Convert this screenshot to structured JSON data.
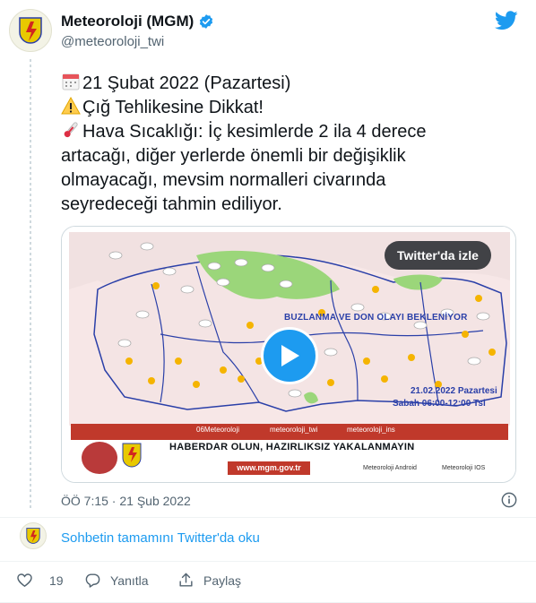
{
  "author": {
    "name": "Meteoroloji (MGM)",
    "handle": "@meteoroloji_twi",
    "avatar_text": "METEOROLOJİ",
    "verified": true
  },
  "tweet": {
    "lines": [
      "21 Şubat 2022 (Pazartesi)",
      "Çığ Tehlikesine Dikkat!",
      "Hava Sıcaklığı: İç kesimlerde 2 ila 4 derece",
      "artacağı, diğer yerlerde önemli bir değişiklik",
      "olmayacağı, mevsim normalleri civarında",
      "seyredeceği tahmin ediliyor."
    ],
    "emoji_names": [
      "calendar-icon",
      "warning-icon",
      "thermometer-icon"
    ]
  },
  "media": {
    "watch_label": "Twitter'da izle",
    "headline": "BUZLANMA VE DON OLAYI BEKLENİYOR",
    "date": "21.02.2022 Pazartesi",
    "time": "Sabah 06:00-12:00 Tsi",
    "social": [
      "06Meteoroloji",
      "meteoroloji_twi",
      "meteoroloji_ins"
    ],
    "slogan": "HABERDAR OLUN, HAZIRLIKSIZ YAKALANMAYIN",
    "url": "www.mgm.gov.tr",
    "apps": [
      "Meteoroloji Android",
      "Meteoroloji IOS"
    ]
  },
  "timestamp": "ÖÖ 7:15 · 21 Şub 2022",
  "thread_link": "Sohbetin tamamını Twitter'da oku",
  "actions": {
    "like_count": "19",
    "reply_label": "Yanıtla",
    "share_label": "Paylaş"
  },
  "colors": {
    "accent": "#1d9bf0",
    "text": "#0f1419",
    "muted": "#536471",
    "map_blue": "#2a3fa8",
    "banner_red": "#c0392b"
  }
}
